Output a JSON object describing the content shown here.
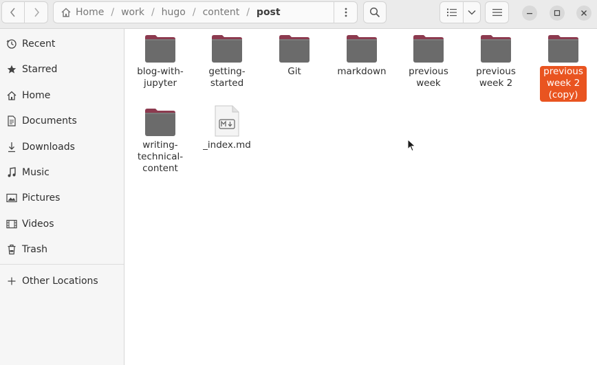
{
  "header": {
    "breadcrumbs": [
      "Home",
      "work",
      "hugo",
      "content",
      "post"
    ],
    "separator": "/"
  },
  "sidebar": {
    "items": [
      {
        "label": "Recent",
        "icon": "clock-icon"
      },
      {
        "label": "Starred",
        "icon": "star-icon"
      },
      {
        "label": "Home",
        "icon": "home-icon"
      },
      {
        "label": "Documents",
        "icon": "document-icon"
      },
      {
        "label": "Downloads",
        "icon": "download-icon"
      },
      {
        "label": "Music",
        "icon": "music-icon"
      },
      {
        "label": "Pictures",
        "icon": "picture-icon"
      },
      {
        "label": "Videos",
        "icon": "video-icon"
      },
      {
        "label": "Trash",
        "icon": "trash-icon"
      }
    ],
    "other_locations": "Other Locations"
  },
  "files": [
    {
      "name": "blog-with-jupyter",
      "lines": [
        "blog-with-",
        "jupyter"
      ],
      "type": "folder",
      "selected": false
    },
    {
      "name": "getting-started",
      "lines": [
        "getting-",
        "started"
      ],
      "type": "folder",
      "selected": false
    },
    {
      "name": "Git",
      "lines": [
        "Git"
      ],
      "type": "folder",
      "selected": false
    },
    {
      "name": "markdown",
      "lines": [
        "markdown"
      ],
      "type": "folder",
      "selected": false
    },
    {
      "name": "previous week",
      "lines": [
        "previous",
        "week"
      ],
      "type": "folder",
      "selected": false
    },
    {
      "name": "previous week 2",
      "lines": [
        "previous",
        "week 2"
      ],
      "type": "folder",
      "selected": false
    },
    {
      "name": "previous week 2 (copy)",
      "lines": [
        "previous",
        "week 2",
        "(copy)"
      ],
      "type": "folder",
      "selected": true
    },
    {
      "name": "writing-technical-content",
      "lines": [
        "writing-",
        "technical-",
        "content"
      ],
      "type": "folder",
      "selected": false
    },
    {
      "name": "_index.md",
      "lines": [
        "_index.md"
      ],
      "type": "markdown-file",
      "selected": false
    }
  ],
  "colors": {
    "accent": "#e95420",
    "folder_body": "#6b6b6b",
    "folder_tab": "#8c3a4f"
  }
}
